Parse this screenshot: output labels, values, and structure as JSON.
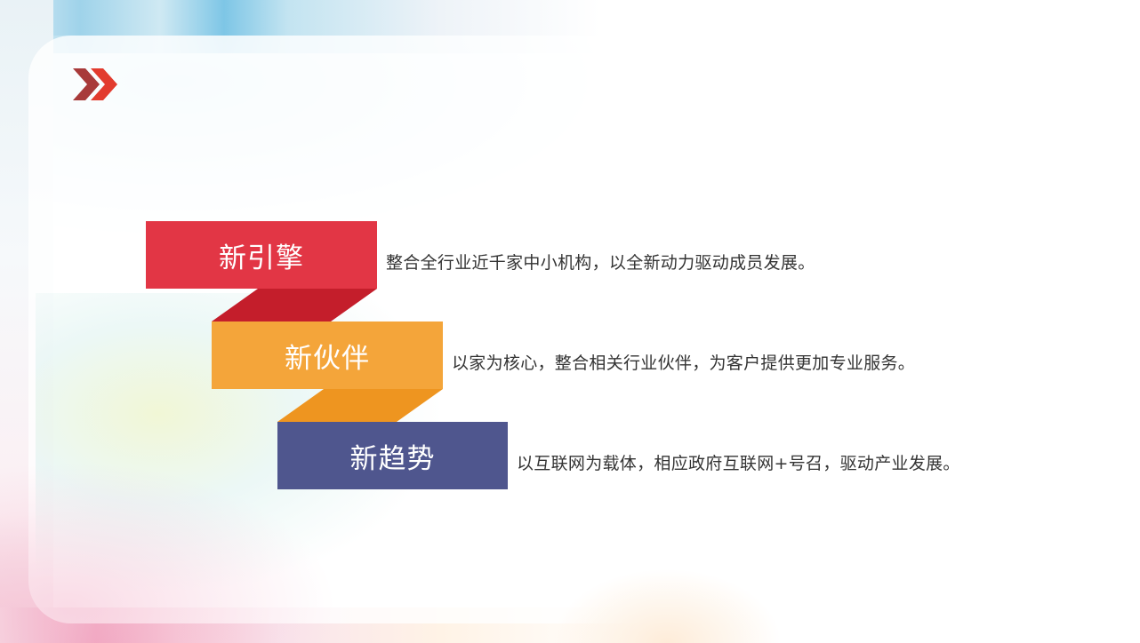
{
  "items": [
    {
      "title": "新引擎",
      "description": "整合全行业近千家中小机构，以全新动力驱动成员发展。",
      "color": "#e23645",
      "fold_color": "#c41e2b"
    },
    {
      "title": "新伙伴",
      "description": "以家为核心，整合相关行业伙伴，为客户提供更加专业服务。",
      "color": "#f4a53a",
      "fold_color": "#ee9520"
    },
    {
      "title": "新趋势",
      "description": "以互联网为载体，相应政府互联网+号召，驱动产业发展。",
      "color": "#4f568e",
      "fold_color": "#3f4679"
    }
  ],
  "icons": {
    "header": "double-chevron-right-icon"
  }
}
